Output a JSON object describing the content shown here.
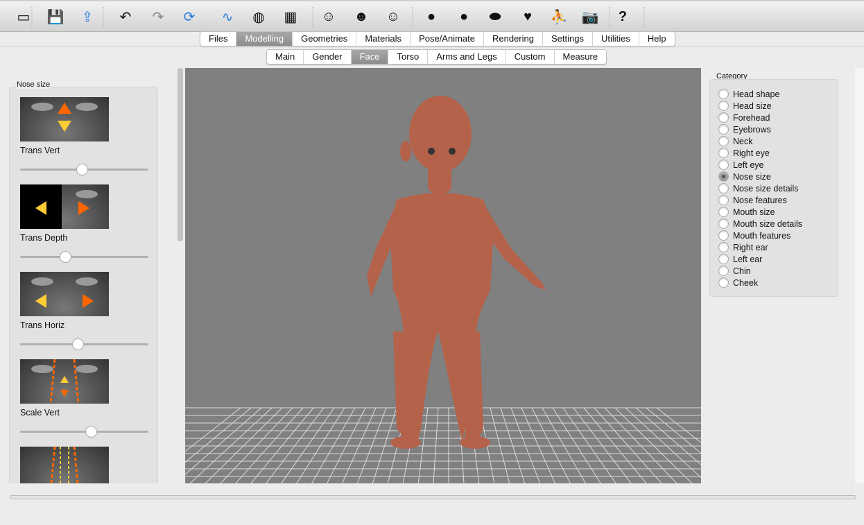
{
  "toolbar": {
    "icons": [
      "window-icon",
      "save-icon",
      "export-icon",
      "undo-icon",
      "redo-icon",
      "reset-icon",
      "smooth-icon",
      "wireframe-icon",
      "background-icon",
      "front-view-icon",
      "back-view-icon",
      "side-view-icon",
      "left-view-icon",
      "right-view-icon",
      "top-view-icon",
      "bottom-view-icon",
      "reset-camera-icon",
      "screenshot-icon",
      "help-icon"
    ],
    "help_label": "?"
  },
  "main_tabs": [
    {
      "label": "Files"
    },
    {
      "label": "Modelling",
      "active": true
    },
    {
      "label": "Geometries"
    },
    {
      "label": "Materials"
    },
    {
      "label": "Pose/Animate"
    },
    {
      "label": "Rendering"
    },
    {
      "label": "Settings"
    },
    {
      "label": "Utilities"
    },
    {
      "label": "Help"
    }
  ],
  "sub_tabs": [
    {
      "label": "Main"
    },
    {
      "label": "Gender"
    },
    {
      "label": "Face",
      "active": true
    },
    {
      "label": "Torso"
    },
    {
      "label": "Arms and Legs"
    },
    {
      "label": "Custom"
    },
    {
      "label": "Measure"
    }
  ],
  "left_panel": {
    "title": "Nose size",
    "sliders": [
      {
        "label": "Trans Vert",
        "value": 0.48
      },
      {
        "label": "Trans Depth",
        "value": 0.35
      },
      {
        "label": "Trans Horiz",
        "value": 0.45
      },
      {
        "label": "Scale Vert",
        "value": 0.55
      }
    ]
  },
  "category": {
    "title": "Category",
    "items": [
      "Head shape",
      "Head size",
      "Forehead",
      "Eyebrows",
      "Neck",
      "Right eye",
      "Left eye",
      "Nose size",
      "Nose size details",
      "Nose features",
      "Mouth size",
      "Mouth size details",
      "Mouth features",
      "Right ear",
      "Left ear",
      "Chin",
      "Cheek"
    ],
    "selected": "Nose size"
  },
  "colors": {
    "viewport_bg": "#808080",
    "skin": "#b4624a",
    "arrow_orange": "#ff6600",
    "arrow_yellow": "#ffcc33"
  }
}
